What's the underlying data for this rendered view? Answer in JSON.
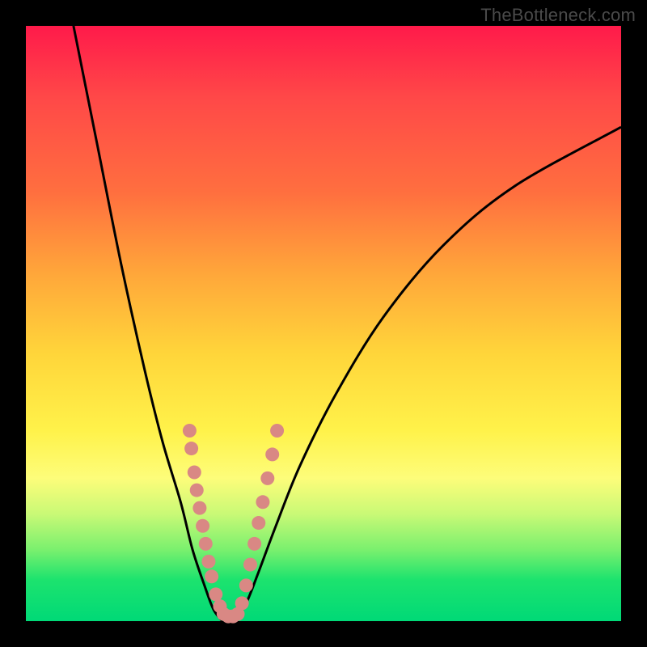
{
  "watermark": "TheBottleneck.com",
  "colors": {
    "frame": "#000000",
    "gradient_top": "#ff1a4a",
    "gradient_bottom": "#00d977",
    "curve": "#000000",
    "marker": "#d98884"
  },
  "chart_data": {
    "type": "line",
    "title": "",
    "xlabel": "",
    "ylabel": "",
    "xlim": [
      0,
      100
    ],
    "ylim": [
      0,
      100
    ],
    "series": [
      {
        "name": "bottleneck-curve-left",
        "x": [
          8,
          12,
          16,
          20,
          23,
          26,
          28,
          30,
          31.5,
          33
        ],
        "y": [
          100,
          80,
          60,
          42,
          30,
          20,
          12,
          6,
          2,
          0
        ]
      },
      {
        "name": "bottleneck-curve-right",
        "x": [
          35,
          37,
          39,
          42,
          46,
          52,
          60,
          70,
          82,
          100
        ],
        "y": [
          0,
          3,
          8,
          16,
          26,
          38,
          51,
          63,
          73,
          83
        ]
      }
    ],
    "markers": {
      "name": "highlighted-points",
      "points": [
        {
          "x": 27.5,
          "y": 32
        },
        {
          "x": 27.8,
          "y": 29
        },
        {
          "x": 28.3,
          "y": 25
        },
        {
          "x": 28.7,
          "y": 22
        },
        {
          "x": 29.2,
          "y": 19
        },
        {
          "x": 29.7,
          "y": 16
        },
        {
          "x": 30.2,
          "y": 13
        },
        {
          "x": 30.7,
          "y": 10
        },
        {
          "x": 31.2,
          "y": 7.5
        },
        {
          "x": 31.9,
          "y": 4.5
        },
        {
          "x": 32.6,
          "y": 2.5
        },
        {
          "x": 33.2,
          "y": 1.2
        },
        {
          "x": 34.0,
          "y": 0.8
        },
        {
          "x": 34.8,
          "y": 0.8
        },
        {
          "x": 35.6,
          "y": 1.2
        },
        {
          "x": 36.3,
          "y": 3
        },
        {
          "x": 37.0,
          "y": 6
        },
        {
          "x": 37.7,
          "y": 9.5
        },
        {
          "x": 38.4,
          "y": 13
        },
        {
          "x": 39.1,
          "y": 16.5
        },
        {
          "x": 39.8,
          "y": 20
        },
        {
          "x": 40.6,
          "y": 24
        },
        {
          "x": 41.4,
          "y": 28
        },
        {
          "x": 42.2,
          "y": 32
        }
      ]
    }
  }
}
